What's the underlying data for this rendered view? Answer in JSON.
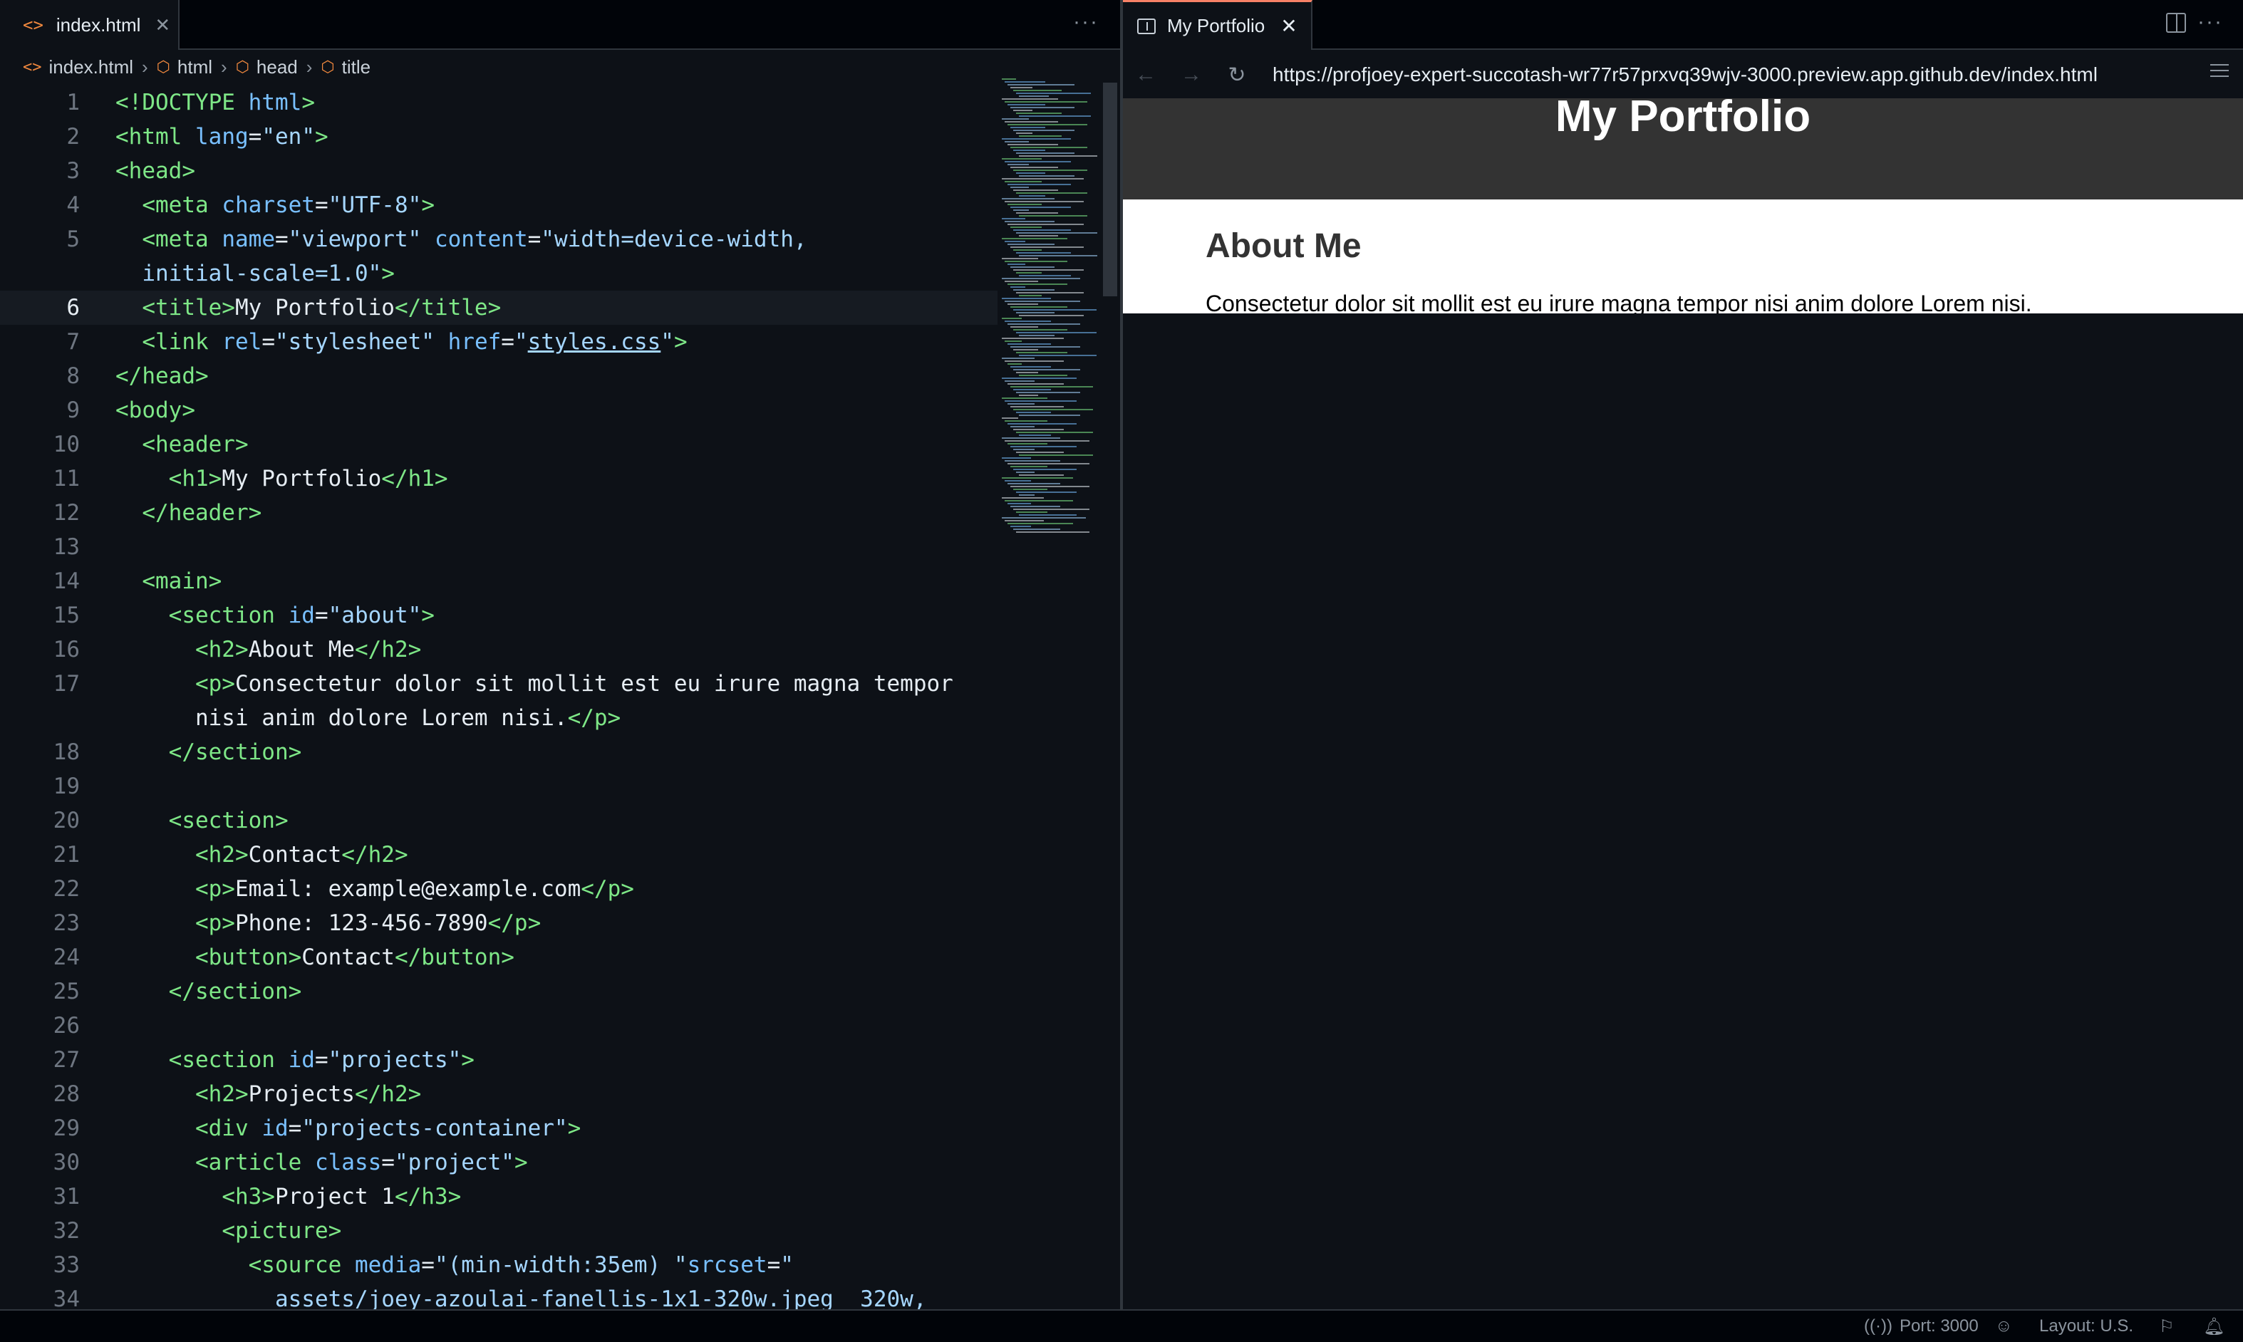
{
  "editor": {
    "tab_label": "index.html",
    "breadcrumb": [
      "index.html",
      "html",
      "head",
      "title"
    ],
    "lines": [
      {
        "n": "1",
        "html": "<span class=\"tg\">&lt;!DOCTYPE</span> <span class=\"at\">html</span><span class=\"tg\">&gt;</span>"
      },
      {
        "n": "2",
        "html": "<span class=\"tg\">&lt;html</span> <span class=\"at\">lang</span>=<span class=\"st\">\"en\"</span><span class=\"tg\">&gt;</span>"
      },
      {
        "n": "3",
        "html": "<span class=\"tg\">&lt;head&gt;</span>"
      },
      {
        "n": "4",
        "html": "  <span class=\"tg\">&lt;meta</span> <span class=\"at\">charset</span>=<span class=\"st\">\"UTF-8\"</span><span class=\"tg\">&gt;</span>"
      },
      {
        "n": "5",
        "html": "  <span class=\"tg\">&lt;meta</span> <span class=\"at\">name</span>=<span class=\"st\">\"viewport\"</span> <span class=\"at\">content</span>=<span class=\"st\">\"width=device-width,</span>"
      },
      {
        "n": "",
        "html": "  <span class=\"st\">initial-scale=1.0\"</span><span class=\"tg\">&gt;</span>"
      },
      {
        "n": "6",
        "html": "  <span class=\"tg\">&lt;title&gt;</span>My Portfolio<span class=\"tg\">&lt;/title&gt;</span>"
      },
      {
        "n": "7",
        "html": "  <span class=\"tg\">&lt;link</span> <span class=\"at\">rel</span>=<span class=\"st\">\"stylesheet\"</span> <span class=\"at\">href</span>=<span class=\"st\">\"<u>styles.css</u>\"</span><span class=\"tg\">&gt;</span>"
      },
      {
        "n": "8",
        "html": "<span class=\"tg\">&lt;/head&gt;</span>"
      },
      {
        "n": "9",
        "html": "<span class=\"tg\">&lt;body&gt;</span>"
      },
      {
        "n": "10",
        "html": "  <span class=\"tg\">&lt;header&gt;</span>"
      },
      {
        "n": "11",
        "html": "    <span class=\"tg\">&lt;h1&gt;</span>My Portfolio<span class=\"tg\">&lt;/h1&gt;</span>"
      },
      {
        "n": "12",
        "html": "  <span class=\"tg\">&lt;/header&gt;</span>"
      },
      {
        "n": "13",
        "html": ""
      },
      {
        "n": "14",
        "html": "  <span class=\"tg\">&lt;main&gt;</span>"
      },
      {
        "n": "15",
        "html": "    <span class=\"tg\">&lt;section</span> <span class=\"at\">id</span>=<span class=\"st\">\"about\"</span><span class=\"tg\">&gt;</span>"
      },
      {
        "n": "16",
        "html": "      <span class=\"tg\">&lt;h2&gt;</span>About Me<span class=\"tg\">&lt;/h2&gt;</span>"
      },
      {
        "n": "17",
        "html": "      <span class=\"tg\">&lt;p&gt;</span>Consectetur dolor sit mollit est eu irure magna tempor"
      },
      {
        "n": "",
        "html": "      nisi anim dolore Lorem nisi.<span class=\"tg\">&lt;/p&gt;</span>"
      },
      {
        "n": "18",
        "html": "    <span class=\"tg\">&lt;/section&gt;</span>"
      },
      {
        "n": "19",
        "html": ""
      },
      {
        "n": "20",
        "html": "    <span class=\"tg\">&lt;section&gt;</span>"
      },
      {
        "n": "21",
        "html": "      <span class=\"tg\">&lt;h2&gt;</span>Contact<span class=\"tg\">&lt;/h2&gt;</span>"
      },
      {
        "n": "22",
        "html": "      <span class=\"tg\">&lt;p&gt;</span>Email: example@example.com<span class=\"tg\">&lt;/p&gt;</span>"
      },
      {
        "n": "23",
        "html": "      <span class=\"tg\">&lt;p&gt;</span>Phone: 123-456-7890<span class=\"tg\">&lt;/p&gt;</span>"
      },
      {
        "n": "24",
        "html": "      <span class=\"tg\">&lt;button&gt;</span>Contact<span class=\"tg\">&lt;/button&gt;</span>"
      },
      {
        "n": "25",
        "html": "    <span class=\"tg\">&lt;/section&gt;</span>"
      },
      {
        "n": "26",
        "html": ""
      },
      {
        "n": "27",
        "html": "    <span class=\"tg\">&lt;section</span> <span class=\"at\">id</span>=<span class=\"st\">\"projects\"</span><span class=\"tg\">&gt;</span>"
      },
      {
        "n": "28",
        "html": "      <span class=\"tg\">&lt;h2&gt;</span>Projects<span class=\"tg\">&lt;/h2&gt;</span>"
      },
      {
        "n": "29",
        "html": "      <span class=\"tg\">&lt;div</span> <span class=\"at\">id</span>=<span class=\"st\">\"projects-container\"</span><span class=\"tg\">&gt;</span>"
      },
      {
        "n": "30",
        "html": "      <span class=\"tg\">&lt;article</span> <span class=\"at\">class</span>=<span class=\"st\">\"project\"</span><span class=\"tg\">&gt;</span>"
      },
      {
        "n": "31",
        "html": "        <span class=\"tg\">&lt;h3&gt;</span>Project 1<span class=\"tg\">&lt;/h3&gt;</span>"
      },
      {
        "n": "32",
        "html": "        <span class=\"tg\">&lt;picture&gt;</span>"
      },
      {
        "n": "33",
        "html": "          <span class=\"tg\">&lt;source</span> <span class=\"at\">media</span>=<span class=\"st\">\"(min-width:35em) \"</span><span class=\"at\">srcset</span>=<span class=\"st\">\"</span>"
      },
      {
        "n": "34",
        "html": "            <span class=\"st\">assets/joey-azoulai-fanellis-1x1-320w.jpeg  320w,</span>"
      }
    ],
    "active_line": "6"
  },
  "browser": {
    "tab_label": "My Portfolio",
    "url": "https://profjoey-expert-succotash-wr77r57prxvq39wjv-3000.preview.app.github.dev/index.html",
    "page": {
      "title": "My Portfolio",
      "about_heading": "About Me",
      "about_text": "Consectetur dolor sit mollit est eu irure magna tempor nisi anim dolore Lorem nisi."
    }
  },
  "status_bar": {
    "port": "Port: 3000",
    "layout": "Layout: U.S."
  },
  "colors": {
    "editor_bg": "#0d1117",
    "tag": "#7ee787",
    "attribute": "#79c0ff",
    "string": "#a5d6ff",
    "site_header": "#333333",
    "tab_accent": "#f78166"
  }
}
